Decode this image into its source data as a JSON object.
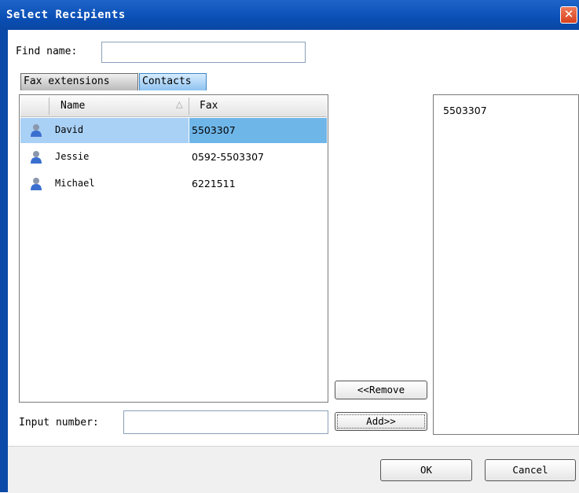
{
  "window": {
    "title": "Select Recipients",
    "close_icon": "close-icon",
    "accent_color": "#0a4fb5"
  },
  "find": {
    "label": "Find name:",
    "value": ""
  },
  "tabs": [
    {
      "label": "Fax extensions",
      "active": false
    },
    {
      "label": "Contacts",
      "active": true
    }
  ],
  "contacts_list": {
    "columns": {
      "name": "Name",
      "fax": "Fax"
    },
    "sort": {
      "column": "Name",
      "icon": "sort-up-icon"
    },
    "rows": [
      {
        "name": "David",
        "fax": "5503307",
        "selected": true,
        "icon": "contact-person-icon"
      },
      {
        "name": "Jessie",
        "fax": "0592-5503307",
        "selected": false,
        "icon": "contact-person-icon"
      },
      {
        "name": "Michael",
        "fax": "6221511",
        "selected": false,
        "icon": "contact-person-icon"
      }
    ]
  },
  "recipients": {
    "items": [
      "5503307"
    ]
  },
  "buttons": {
    "remove": "<<Remove",
    "add": "Add>>",
    "ok": "OK",
    "cancel": "Cancel"
  },
  "input_number": {
    "label": "Input number:",
    "value": ""
  }
}
